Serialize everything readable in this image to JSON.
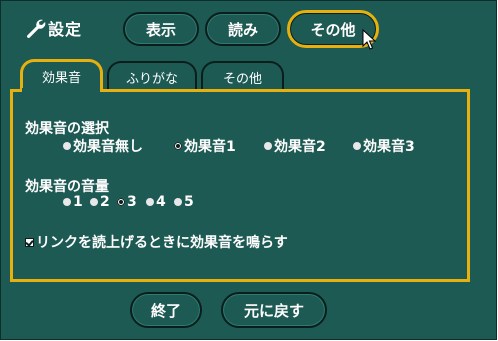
{
  "header": {
    "settings_icon": "wrench-icon",
    "title": "設定",
    "buttons": [
      "表示",
      "読み",
      "その他"
    ]
  },
  "tabs": [
    "効果音",
    "ふりがな",
    "その他"
  ],
  "sound_select": {
    "title": "効果音の選択",
    "options": [
      "効果音無し",
      "効果音1",
      "効果音2",
      "効果音3"
    ],
    "selected": "効果音1"
  },
  "volume": {
    "title": "効果音の音量",
    "options": [
      "1",
      "2",
      "3",
      "4",
      "5"
    ],
    "selected": "3"
  },
  "link_sound": {
    "label": "リンクを読上げるときに効果音を鳴らす",
    "checked": true
  },
  "footer": {
    "end_label": "終了",
    "reset_label": "元に戻す"
  },
  "colors": {
    "background": "#1d5a53",
    "accent": "#e6b00e"
  }
}
